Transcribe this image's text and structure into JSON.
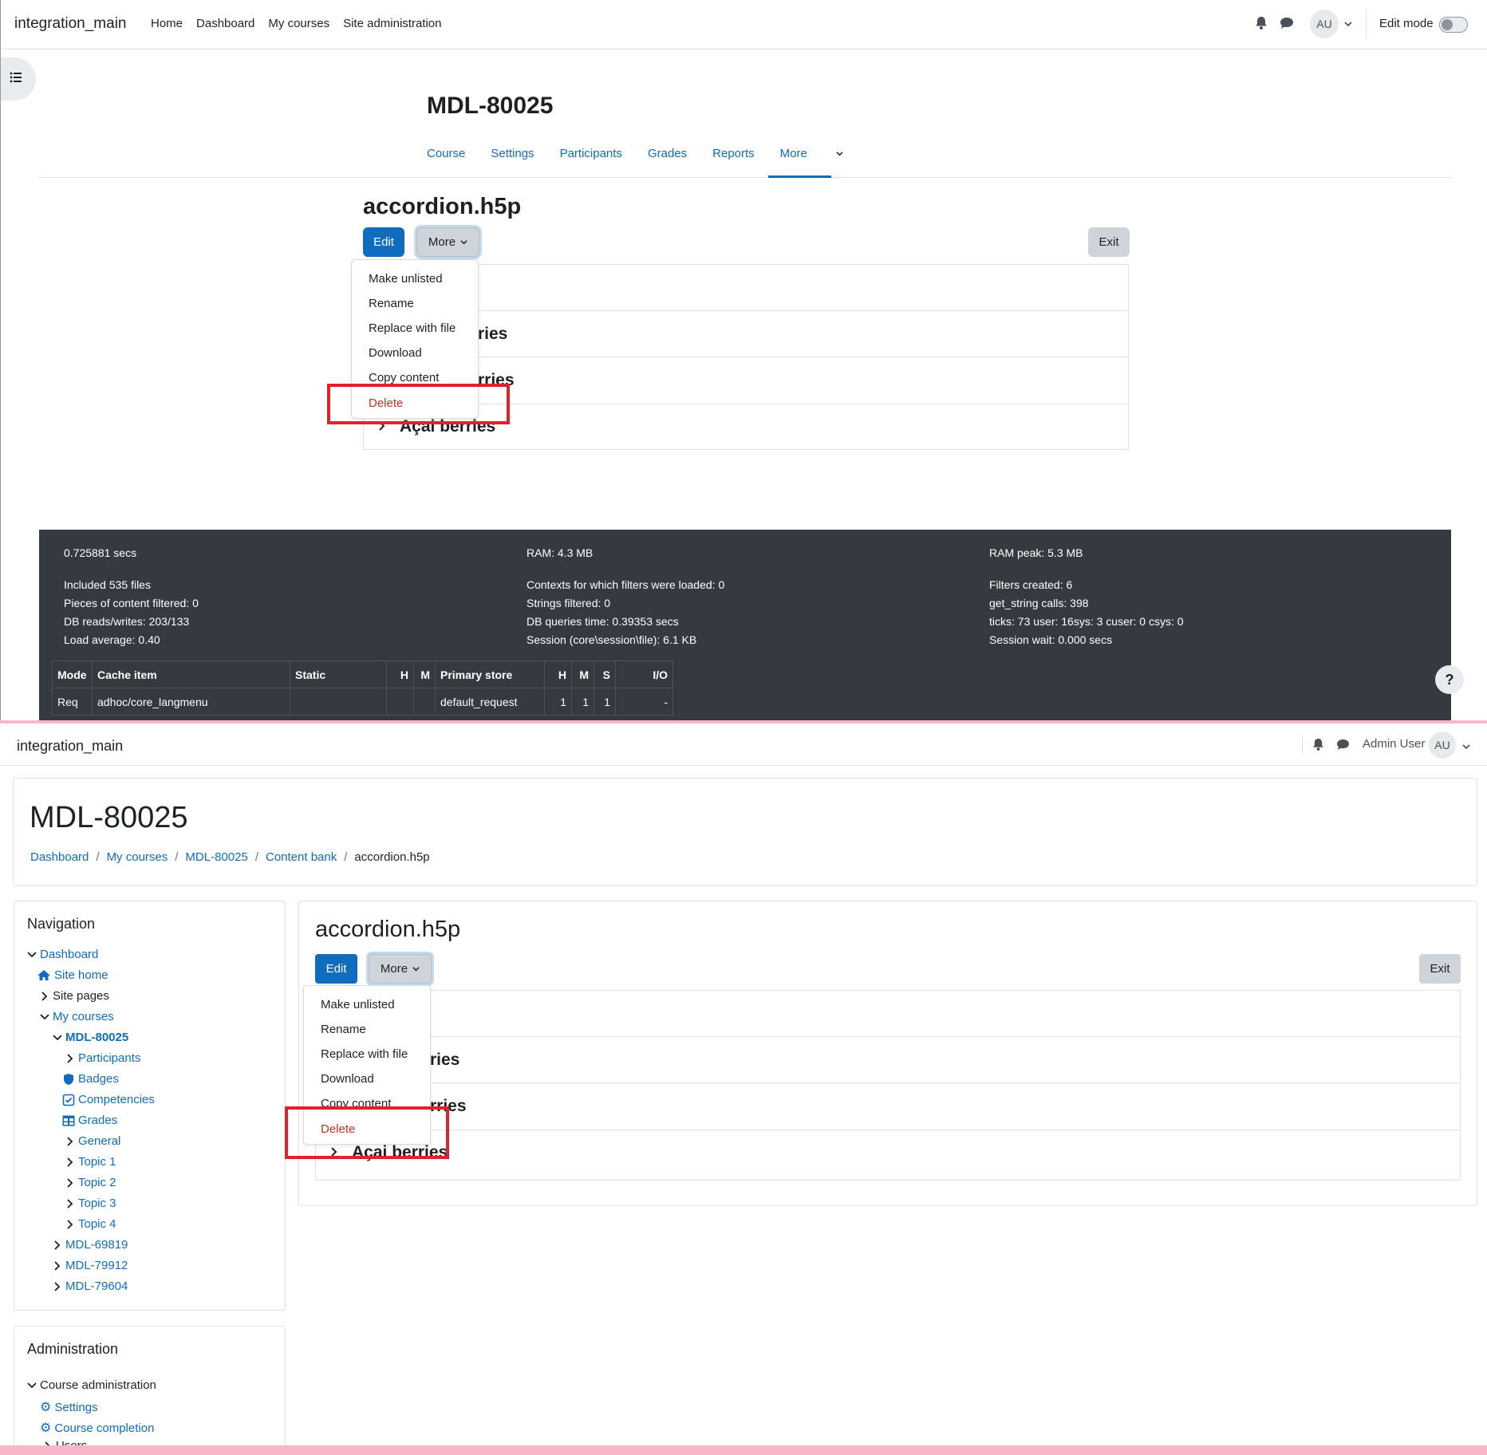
{
  "top": {
    "site_name": "integration_main",
    "nav": [
      "Home",
      "Dashboard",
      "My courses",
      "Site administration"
    ],
    "avatar_initials": "AU",
    "edit_mode_label": "Edit mode",
    "course_title": "MDL-80025",
    "tabs": [
      "Course",
      "Settings",
      "Participants",
      "Grades",
      "Reports",
      "More"
    ],
    "content_title": "accordion.h5p",
    "edit_button": "Edit",
    "more_button": "More",
    "exit_button": "Exit",
    "menu": [
      "Make unlisted",
      "Rename",
      "Replace with file",
      "Download",
      "Copy content",
      "Delete"
    ],
    "accordion_partial": [
      "ries",
      "rries",
      "Açai berries"
    ],
    "perf": {
      "col1": [
        "0.725881 secs",
        "Included 535 files",
        "Pieces of content filtered: 0",
        "DB reads/writes: 203/133",
        "Load average: 0.40"
      ],
      "col2": [
        "RAM: 4.3 MB",
        "Contexts for which filters were loaded: 0",
        "Strings filtered: 0",
        "DB queries time: 0.39353 secs",
        "Session (core\\session\\file): 6.1 KB"
      ],
      "col3": [
        "RAM peak: 5.3 MB",
        "Filters created: 6",
        "get_string calls: 398",
        "ticks: 73 user: 16sys: 3 cuser: 0 csys: 0",
        "Session wait: 0.000 secs"
      ],
      "table_headers": [
        "Mode",
        "Cache item",
        "Static",
        "H",
        "M",
        "Primary store",
        "H",
        "M",
        "S",
        "I/O"
      ],
      "table_row": [
        "Req",
        "adhoc/core_langmenu",
        "",
        "",
        "",
        "default_request",
        "1",
        "1",
        "1",
        "-"
      ]
    },
    "help": "?"
  },
  "bottom": {
    "site_name": "integration_main",
    "user_name": "Admin User",
    "avatar_initials": "AU",
    "course_title": "MDL-80025",
    "breadcrumbs": [
      "Dashboard",
      "My courses",
      "MDL-80025",
      "Content bank",
      "accordion.h5p"
    ],
    "navigation_title": "Navigation",
    "nav_tree": [
      "Dashboard",
      "Site home",
      "Site pages",
      "My courses",
      "MDL-80025",
      "Participants",
      "Badges",
      "Competencies",
      "Grades",
      "General",
      "Topic 1",
      "Topic 2",
      "Topic 3",
      "Topic 4",
      "MDL-69819",
      "MDL-79912",
      "MDL-79604"
    ],
    "admin_title": "Administration",
    "admin_tree": [
      "Course administration",
      "Settings",
      "Course completion",
      "Users"
    ],
    "content_title": "accordion.h5p",
    "edit_button": "Edit",
    "more_button": "More",
    "exit_button": "Exit",
    "menu": [
      "Make unlisted",
      "Rename",
      "Replace with file",
      "Download",
      "Copy content",
      "Delete"
    ],
    "accordion_partial": [
      "ries",
      "rries",
      "Açai berries"
    ]
  },
  "colors": {
    "primary": "#0f6cbf",
    "danger": "#ca3120",
    "highlight": "#e0232b",
    "footer": "#343a40"
  }
}
